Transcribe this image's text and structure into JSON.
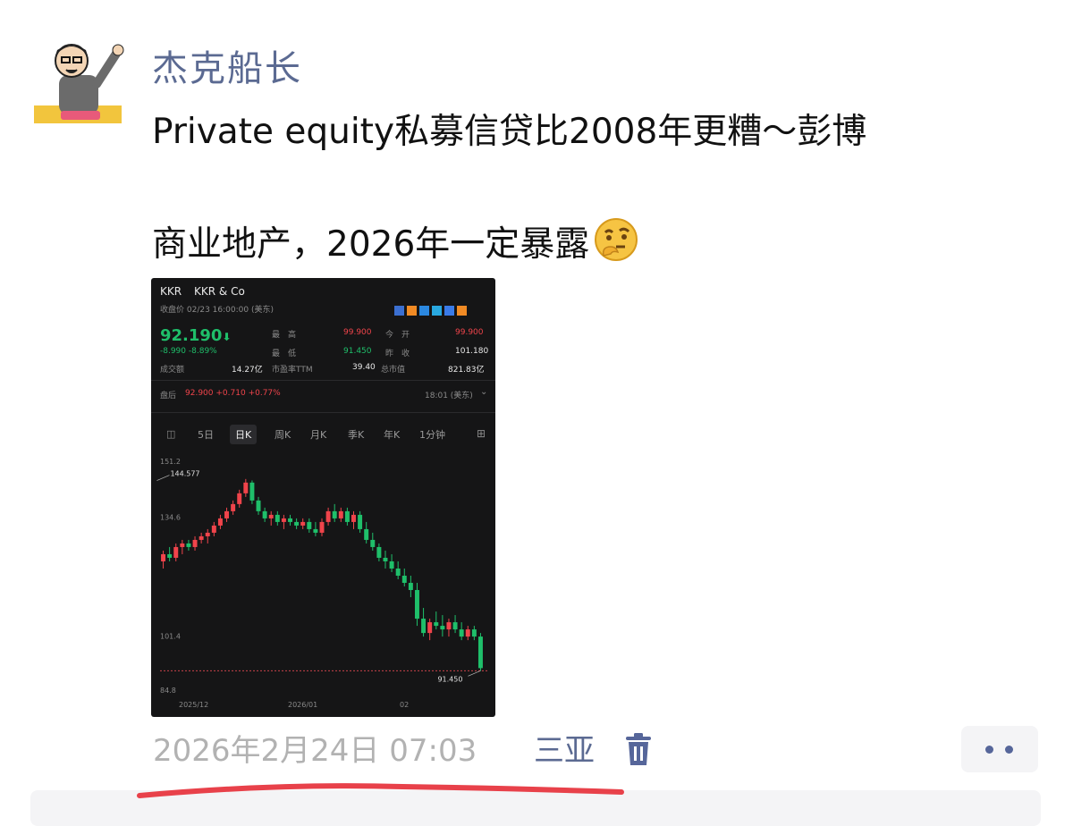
{
  "user": {
    "name": "杰克船长",
    "avatar_icon": "cartoon-avatar-icon"
  },
  "post": {
    "line1": "Private equity私募信贷比2008年更糟～彭博",
    "line2": "商业地产，2026年一定暴露",
    "emoji": "thinking-face-icon"
  },
  "stock": {
    "ticker": "KKR",
    "name": "KKR & Co",
    "close_info": "收盘价 02/23 16:00:00 (美东)",
    "price": "92.190",
    "price_arrow": "⬇",
    "change": "-8.990",
    "change_pct": "-8.89%",
    "stats": {
      "high_label": "最　高",
      "high": "99.900",
      "open_label": "今　开",
      "open": "99.900",
      "low_label": "最　低",
      "low": "91.450",
      "prev_label": "昨　收",
      "prev": "101.180",
      "volume_label": "成交额",
      "volume": "14.27亿",
      "pe_label": "市盈率TTM",
      "pe": "39.40",
      "mcap_label": "总市值",
      "mcap": "821.83亿"
    },
    "after_hours": {
      "label": "盘后",
      "price": "92.900",
      "change": "+0.710",
      "pct": "+0.77%",
      "time": "18:01 (美东)"
    },
    "tabs": [
      "5日",
      "日K",
      "周K",
      "月K",
      "季K",
      "年K",
      "1分钟"
    ],
    "active_tab": "日K",
    "colors": {
      "up": "#f0444b",
      "down": "#1fbf6a",
      "bg": "#151516"
    }
  },
  "chart_data": {
    "type": "candlestick",
    "y_ticks": [
      "151.2",
      "134.6",
      "101.4",
      "84.8"
    ],
    "ylim": [
      84.8,
      151.2
    ],
    "x_ticks": [
      "2025/12",
      "2026/01",
      "02"
    ],
    "annotations": [
      {
        "text": "144.577",
        "value": 144.577
      },
      {
        "text": "91.450",
        "value": 91.45
      }
    ],
    "candles": [
      [
        122,
        125,
        120,
        124
      ],
      [
        124,
        126,
        122,
        123
      ],
      [
        123,
        127,
        122,
        126
      ],
      [
        126,
        128,
        124,
        127
      ],
      [
        127,
        128,
        125,
        126
      ],
      [
        126,
        129,
        125,
        128
      ],
      [
        128,
        130,
        127,
        129
      ],
      [
        129,
        131,
        127,
        130
      ],
      [
        130,
        133,
        129,
        132
      ],
      [
        132,
        135,
        131,
        134
      ],
      [
        134,
        137,
        133,
        136
      ],
      [
        136,
        139,
        135,
        138
      ],
      [
        138,
        142,
        137,
        141
      ],
      [
        141,
        145,
        140,
        144
      ],
      [
        144,
        144.6,
        138,
        139
      ],
      [
        139,
        140,
        135,
        136
      ],
      [
        136,
        137,
        133,
        134
      ],
      [
        134,
        136,
        132,
        135
      ],
      [
        135,
        136,
        132,
        133
      ],
      [
        133,
        135,
        131,
        134
      ],
      [
        134,
        135,
        132,
        133
      ],
      [
        133,
        134,
        131,
        132
      ],
      [
        132,
        134,
        131,
        133
      ],
      [
        133,
        134,
        130,
        131
      ],
      [
        131,
        133,
        129,
        130
      ],
      [
        130,
        134,
        129,
        133
      ],
      [
        133,
        137,
        132,
        136
      ],
      [
        136,
        138,
        133,
        134
      ],
      [
        134,
        137,
        133,
        136
      ],
      [
        136,
        137,
        132,
        133
      ],
      [
        133,
        136,
        131,
        135
      ],
      [
        135,
        136,
        130,
        131
      ],
      [
        131,
        133,
        127,
        128
      ],
      [
        128,
        130,
        125,
        126
      ],
      [
        126,
        127,
        122,
        123
      ],
      [
        123,
        125,
        120,
        122
      ],
      [
        122,
        124,
        119,
        120
      ],
      [
        120,
        122,
        117,
        118
      ],
      [
        118,
        120,
        115,
        116
      ],
      [
        116,
        118,
        112,
        114
      ],
      [
        114,
        116,
        104,
        106
      ],
      [
        106,
        109,
        101,
        102
      ],
      [
        102,
        106,
        100,
        105
      ],
      [
        105,
        108,
        103,
        104
      ],
      [
        104,
        107,
        101,
        103
      ],
      [
        103,
        106,
        101,
        105
      ],
      [
        105,
        107,
        102,
        103
      ],
      [
        103,
        105,
        100,
        101
      ],
      [
        101,
        104,
        100,
        103
      ],
      [
        103,
        104,
        100,
        101
      ],
      [
        101,
        102,
        91.45,
        92.19
      ]
    ]
  },
  "meta": {
    "timestamp": "2026年2月24日 07:03",
    "location": "三亚"
  }
}
